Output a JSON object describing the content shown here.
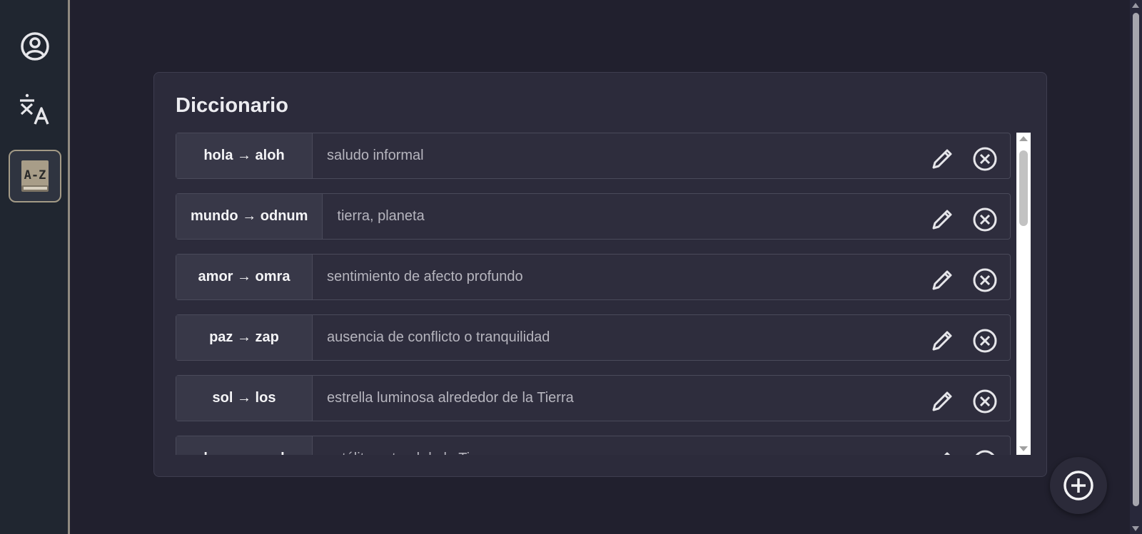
{
  "sidebar": {
    "items": [
      {
        "icon": "user-circle-icon"
      },
      {
        "icon": "translate-icon"
      },
      {
        "icon": "dictionary-az-icon",
        "active": true
      }
    ]
  },
  "panel": {
    "title": "Diccionario"
  },
  "entries": [
    {
      "word": "hola → aloh",
      "definition": "saludo informal"
    },
    {
      "word": "mundo → odnum",
      "definition": "tierra, planeta"
    },
    {
      "word": "amor → omra",
      "definition": "sentimiento de afecto profundo"
    },
    {
      "word": "paz → zap",
      "definition": "ausencia de conflicto o tranquilidad"
    },
    {
      "word": "sol → los",
      "definition": "estrella luminosa alrededor de la Tierra"
    },
    {
      "word": "luna → anul",
      "definition": "satélite natural de la Tierra"
    }
  ],
  "actions": {
    "edit_icon": "pencil-icon",
    "delete_icon": "close-circle-icon",
    "add_icon": "plus-circle-icon"
  },
  "colors": {
    "background": "#21202e",
    "sidebar": "#202630",
    "panel": "#2c2b3b",
    "accent_border": "#a39a86",
    "icon": "#e6e6ea"
  }
}
